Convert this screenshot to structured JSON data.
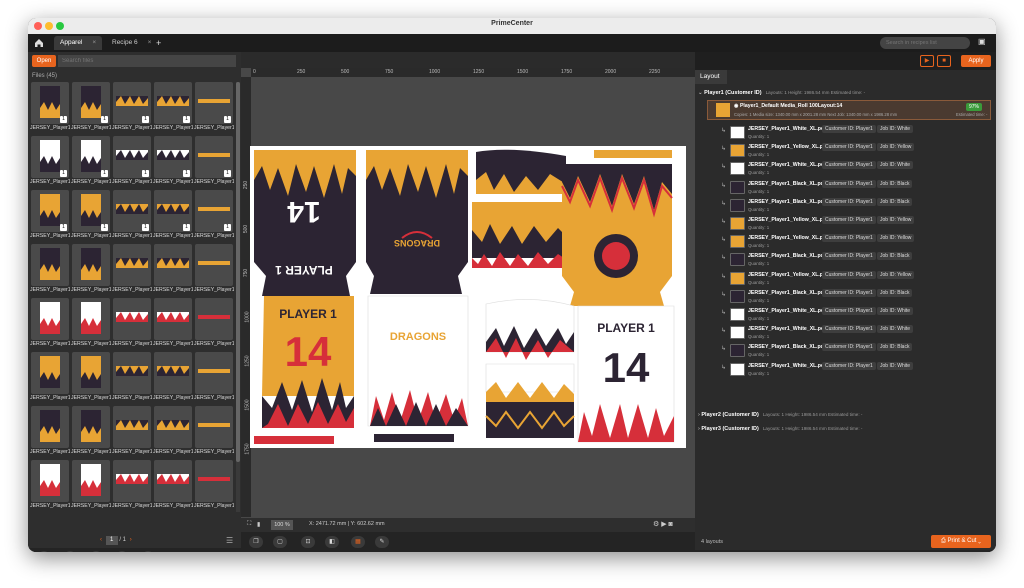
{
  "window": {
    "title": "PrimeCenter"
  },
  "tabs": [
    {
      "label": "Apparel",
      "close": "×"
    },
    {
      "label": "Recipe 6",
      "close": "×"
    }
  ],
  "add_tab": "+",
  "recipe_search": {
    "placeholder": "Search in recipes list"
  },
  "left": {
    "open_label": "Open",
    "search_placeholder": "Search files",
    "files_header": "Files (45)",
    "thumb_name": "JERSEY_Player1",
    "qty": "1",
    "pager": {
      "prev": "‹",
      "page": "1",
      "total": "/ 1",
      "next": "›"
    }
  },
  "canvas": {
    "hticks": [
      "0",
      "250",
      "500",
      "750",
      "1000",
      "1250",
      "1500",
      "1750",
      "2000",
      "2250"
    ],
    "vticks": [
      "250",
      "500",
      "750",
      "1000",
      "1250",
      "1500",
      "1750"
    ],
    "zoom": "100 %",
    "coords": "X: 2471.72 mm  |  Y: 602.62 mm",
    "print": {
      "player": "PLAYER 1",
      "number": "14",
      "team": "DRAGONS"
    }
  },
  "right": {
    "tab": "Layout",
    "apply": "Apply",
    "groups": [
      {
        "name": "Player1 (Customer ID)",
        "meta": "Layouts: 1    Height: 1986.54 mm    Estimated time: -"
      },
      {
        "name": "Player2 (Customer ID)",
        "meta": "Layouts: 1    Height: 1986.54 mm    Estimated time: -"
      },
      {
        "name": "Player3 (Customer ID)",
        "meta": "Layouts: 1    Height: 1986.54 mm    Estimated time: -"
      }
    ],
    "layout": {
      "name": "Player1_Default Media_Roll 100Layout:14",
      "meta": "Copies: 1    Media size: 1340.00 mm x 2001.28 mm    Next Job: 1340.00 mm x 1986.28 mm",
      "badge": "97%",
      "est": "Estimated time: -"
    },
    "jobs": [
      {
        "name": "JERSEY_Player1_White_XL.pdf",
        "cid": "Customer ID: Player1",
        "job": "Job ID: White",
        "qty": "Quantity: 1",
        "color": "#ffffff"
      },
      {
        "name": "JERSEY_Player1_Yellow_XL.pdf",
        "cid": "Customer ID: Player1",
        "job": "Job ID: Yellow",
        "qty": "Quantity: 1",
        "color": "#e8a434"
      },
      {
        "name": "JERSEY_Player1_White_XL.pdf",
        "cid": "Customer ID: Player1",
        "job": "Job ID: White",
        "qty": "Quantity: 1",
        "color": "#ffffff"
      },
      {
        "name": "JERSEY_Player1_Black_XL.pdf",
        "cid": "Customer ID: Player1",
        "job": "Job ID: Black",
        "qty": "Quantity: 1",
        "color": "#2c2433"
      },
      {
        "name": "JERSEY_Player1_Black_XL.pdf",
        "cid": "Customer ID: Player1",
        "job": "Job ID: Black",
        "qty": "Quantity: 1",
        "color": "#2c2433"
      },
      {
        "name": "JERSEY_Player1_Yellow_XL.pdf",
        "cid": "Customer ID: Player1",
        "job": "Job ID: Yellow",
        "qty": "Quantity: 1",
        "color": "#e8a434"
      },
      {
        "name": "JERSEY_Player1_Yellow_XL.pdf",
        "cid": "Customer ID: Player1",
        "job": "Job ID: Yellow",
        "qty": "Quantity: 1",
        "color": "#e8a434"
      },
      {
        "name": "JERSEY_Player1_Black_XL.pdf",
        "cid": "Customer ID: Player1",
        "job": "Job ID: Black",
        "qty": "Quantity: 1",
        "color": "#2c2433"
      },
      {
        "name": "JERSEY_Player1_Yellow_XL.pdf",
        "cid": "Customer ID: Player1",
        "job": "Job ID: Yellow",
        "qty": "Quantity: 1",
        "color": "#e8a434"
      },
      {
        "name": "JERSEY_Player1_Black_XL.pdf",
        "cid": "Customer ID: Player1",
        "job": "Job ID: Black",
        "qty": "Quantity: 1",
        "color": "#2c2433"
      },
      {
        "name": "JERSEY_Player1_White_XL.pdf",
        "cid": "Customer ID: Player1",
        "job": "Job ID: White",
        "qty": "Quantity: 1",
        "color": "#ffffff"
      },
      {
        "name": "JERSEY_Player1_White_XL.pdf",
        "cid": "Customer ID: Player1",
        "job": "Job ID: White",
        "qty": "Quantity: 1",
        "color": "#ffffff"
      },
      {
        "name": "JERSEY_Player1_Black_XL.pdf",
        "cid": "Customer ID: Player1",
        "job": "Job ID: Black",
        "qty": "Quantity: 1",
        "color": "#2c2433"
      },
      {
        "name": "JERSEY_Player1_White_XL.pdf",
        "cid": "Customer ID: Player1",
        "job": "Job ID: White",
        "qty": "Quantity: 1",
        "color": "#ffffff"
      }
    ],
    "layouts_count": "4 layouts",
    "print_cut": "Print & Cut"
  },
  "colors": {
    "accent": "#e8641e",
    "navy": "#2c2433",
    "yellow": "#e8a434",
    "red": "#d62f3a"
  }
}
